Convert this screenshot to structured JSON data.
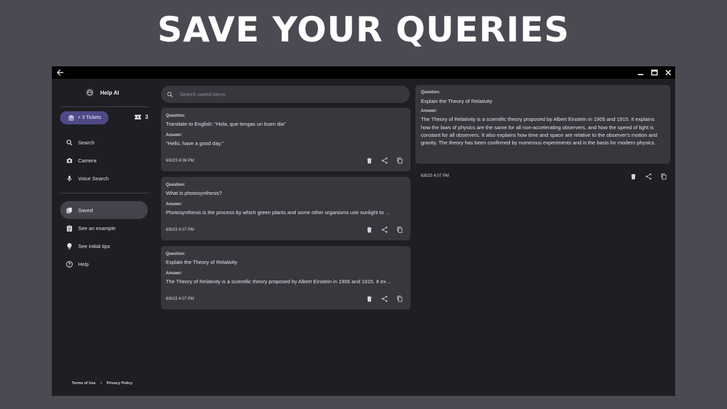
{
  "headline": "SAVE YOUR QUERIES",
  "sidebar": {
    "app_name": "Help AI",
    "tickets_button": "+ 3 Tickets",
    "ticket_count": "3",
    "items": [
      {
        "label": "Search",
        "icon": "search-icon"
      },
      {
        "label": "Camera",
        "icon": "camera-icon"
      },
      {
        "label": "Voice Search",
        "icon": "mic-icon"
      },
      {
        "label": "Saved",
        "icon": "saved-icon",
        "active": true
      },
      {
        "label": "See an example",
        "icon": "clipboard-icon"
      },
      {
        "label": "See initial tips",
        "icon": "lightbulb-icon"
      },
      {
        "label": "Help",
        "icon": "help-icon"
      }
    ],
    "footer": {
      "terms": "Terms of Use",
      "separator": "•",
      "privacy": "Privacy Policy"
    }
  },
  "search": {
    "placeholder": "Search saved items"
  },
  "cards": [
    {
      "question_label": "Question:",
      "question": "Translate to English: \"Hola, que tengas un buen dia\"",
      "answer_label": "Answer:",
      "answer": "\"Hello, have a good day.\"",
      "date": "6/8/23 4:08 PM"
    },
    {
      "question_label": "Question:",
      "question": "What is photosynthesis?",
      "answer_label": "Answer:",
      "answer": "Photosynthesis is the process by which green plants and some other organisms use sunlight to …",
      "date": "6/8/23 4:07 PM"
    },
    {
      "question_label": "Question:",
      "question": "Explain the Theory of Relativity",
      "answer_label": "Answer:",
      "answer": "The Theory of Relativity is a scientific theory proposed by Albert Einstein in 1905 and 1915. It ex…",
      "date": "6/8/23 4:07 PM"
    }
  ],
  "detail": {
    "question_label": "Question:",
    "question": "Explain the Theory of Relativity",
    "answer_label": "Answer:",
    "answer": "The Theory of Relativity is a scientific theory proposed by Albert Einstein in 1905 and 1915. It explains how the laws of physics are the same for all non-accelerating observers, and how the speed of light is constant for all observers. It also explains how time and space are relative to the observer's motion and gravity. The theory has been confirmed by numerous experiments and is the basis for modern physics.",
    "date": "6/8/23 4:07 PM"
  },
  "colors": {
    "accent": "#4f4a86",
    "background": "#1f1e22",
    "card": "#38373e",
    "frame": "#4a4a52"
  }
}
